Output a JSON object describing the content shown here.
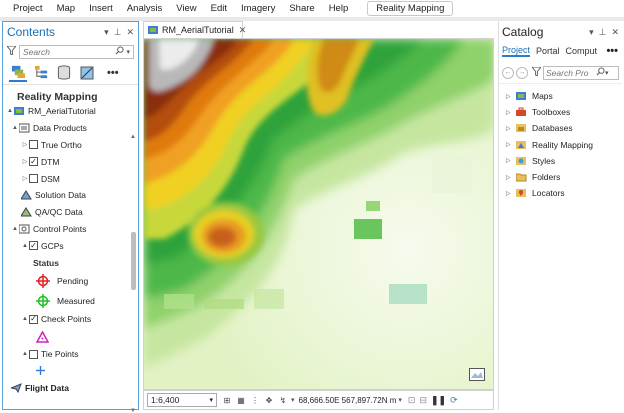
{
  "menu": {
    "items": [
      "Project",
      "Map",
      "Insert",
      "Analysis",
      "View",
      "Edit",
      "Imagery",
      "Share",
      "Help"
    ],
    "context_tab": "Reality Mapping"
  },
  "contents": {
    "title": "Contents",
    "search_placeholder": "Search",
    "map_title": "Reality Mapping",
    "tree": [
      {
        "label": "RM_AerialTutorial",
        "twisty": "▲",
        "check": "",
        "icon": "project-icon"
      },
      {
        "label": "Data Products",
        "twisty": "▲",
        "check": "",
        "icon": "folder-icon"
      },
      {
        "label": "True Ortho",
        "twisty": "▷",
        "check": "",
        "icon": ""
      },
      {
        "label": "DTM",
        "twisty": "▷",
        "check": "✓",
        "icon": ""
      },
      {
        "label": "DSM",
        "twisty": "▷",
        "check": "",
        "icon": ""
      },
      {
        "label": "Solution Data",
        "twisty": "",
        "check": "",
        "icon": "solution-icon"
      },
      {
        "label": "QA/QC Data",
        "twisty": "",
        "check": "",
        "icon": "qaqc-icon"
      },
      {
        "label": "Control Points",
        "twisty": "▲",
        "check": "",
        "icon": "control-points-icon"
      },
      {
        "label": "GCPs",
        "twisty": "▲",
        "check": "✓",
        "icon": ""
      },
      {
        "label": "Status",
        "twisty": "",
        "check": "",
        "icon": ""
      },
      {
        "label": "Pending",
        "twisty": "",
        "check": "",
        "icon": "pending-symbol-icon"
      },
      {
        "label": "Measured",
        "twisty": "",
        "check": "",
        "icon": "measured-symbol-icon"
      },
      {
        "label": "Check Points",
        "twisty": "▲",
        "check": "✓",
        "icon": ""
      },
      {
        "label": "",
        "twisty": "",
        "check": "",
        "icon": "checkpoint-symbol-icon"
      },
      {
        "label": "Tie Points",
        "twisty": "▲",
        "check": "",
        "icon": ""
      },
      {
        "label": "",
        "twisty": "",
        "check": "",
        "icon": "tiepoint-symbol-icon"
      },
      {
        "label": "Flight Data",
        "twisty": "",
        "check": "",
        "icon": "flight-icon"
      }
    ]
  },
  "map": {
    "tab_label": "RM_AerialTutorial",
    "scale": "1:6,400",
    "coordinates": "68,666.50E 567,897.72N m"
  },
  "catalog": {
    "title": "Catalog",
    "tabs": [
      "Project",
      "Portal",
      "Comput"
    ],
    "search_placeholder": "Search Pro",
    "items": [
      {
        "label": "Maps",
        "icon": "maps-icon"
      },
      {
        "label": "Toolboxes",
        "icon": "toolboxes-icon"
      },
      {
        "label": "Databases",
        "icon": "databases-icon"
      },
      {
        "label": "Reality Mapping",
        "icon": "reality-mapping-icon"
      },
      {
        "label": "Styles",
        "icon": "styles-icon"
      },
      {
        "label": "Folders",
        "icon": "folders-icon"
      },
      {
        "label": "Locators",
        "icon": "locators-icon"
      }
    ]
  },
  "colors": {
    "accent": "#1a6fb5",
    "pane_border": "#5aa0d8"
  }
}
